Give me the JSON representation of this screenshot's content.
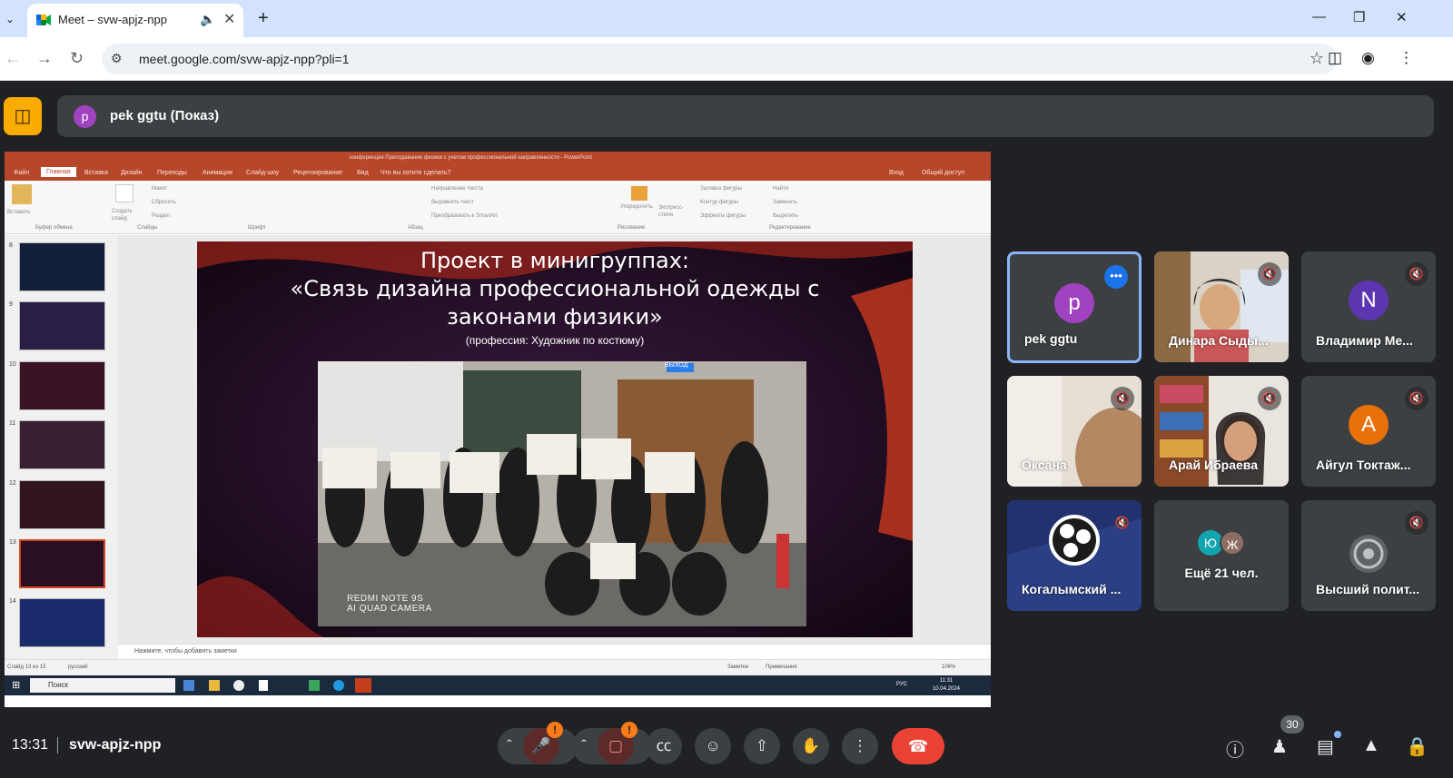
{
  "browser": {
    "tab_title": "Meet – svw-apjz-npp",
    "url": "meet.google.com/svw-apjz-npp?pli=1"
  },
  "meet": {
    "presenter_initial": "p",
    "presenter_label": "pek ggtu (Показ)",
    "time": "13:31",
    "meeting_code": "svw-apjz-npp",
    "participant_count": "30",
    "colors": {
      "end_call": "#ea4335",
      "active_tile": "#8ab4f8",
      "warning": "#fa7b17"
    }
  },
  "presentation": {
    "window_title": "конференция Преподавание физики с учетом профессиональной направленности - PowerPoint",
    "menu": [
      "Файл",
      "Главная",
      "Вставка",
      "Дизайн",
      "Переходы",
      "Анимация",
      "Слайд-шоу",
      "Рецензирование",
      "Вид",
      "Что вы хотите сделать?"
    ],
    "menu_right": [
      "Вход",
      "Общий доступ"
    ],
    "ribbon_groups": [
      "Буфер обмена",
      "Слайды",
      "Шрифт",
      "Абзац",
      "Рисование",
      "Редактирование"
    ],
    "ribbon_items": [
      "Вставить",
      "Создать слайд",
      "Макет",
      "Сбросить",
      "Раздел",
      "Направление текста",
      "Выровнять текст",
      "Преобразовать в SmartArt",
      "Упорядочить",
      "Экспресс-стили",
      "Заливка фигуры",
      "Контур фигуры",
      "Эффекты фигуры",
      "Найти",
      "Заменить",
      "Выделить"
    ],
    "thumb_numbers": [
      "8",
      "9",
      "10",
      "11",
      "12",
      "13",
      "14"
    ],
    "slide_title_lines": [
      "Проект в минигруппах:",
      "«Связь дизайна профессиональной одежды с",
      "законами физики»"
    ],
    "slide_subtitle": "(профессия: Художник по костюму)",
    "camera_text_1": "REDMI NOTE 9S",
    "camera_text_2": "AI QUAD CAMERA",
    "exit_sign": "ВЫХОД",
    "notes_placeholder": "Нажмите, чтобы добавить заметки",
    "status_slide": "Слайд 13 из 15",
    "status_lang": "русский",
    "status_notes": "Заметки",
    "status_comments": "Примечания",
    "zoom": "106%",
    "taskbar_search": "Поиск",
    "taskbar_lang": "РУС",
    "taskbar_time": "11:31",
    "taskbar_date": "10.04.2024"
  },
  "participants": [
    {
      "name": "pek ggtu",
      "initial": "p",
      "color": "#a142c1",
      "muted": false,
      "active": true
    },
    {
      "name": "Динара Сыды...",
      "muted": true,
      "video": true
    },
    {
      "name": "Владимир Ме...",
      "initial": "N",
      "color": "#5e35b1",
      "muted": true
    },
    {
      "name": "Оксана",
      "muted": true,
      "video": true
    },
    {
      "name": "Арай Ибраева",
      "muted": true,
      "video": true
    },
    {
      "name": "Айгул Токтаж...",
      "initial": "A",
      "color": "#e8710a",
      "muted": true
    },
    {
      "name": "Когалымский ...",
      "muted": true,
      "video": true
    },
    {
      "name": "Ещё 21 чел.",
      "initials": [
        "Ю",
        "Ж"
      ],
      "colors": [
        "#12a4af",
        "#8d6e63"
      ]
    },
    {
      "name": "Высший полит...",
      "muted": true
    }
  ]
}
